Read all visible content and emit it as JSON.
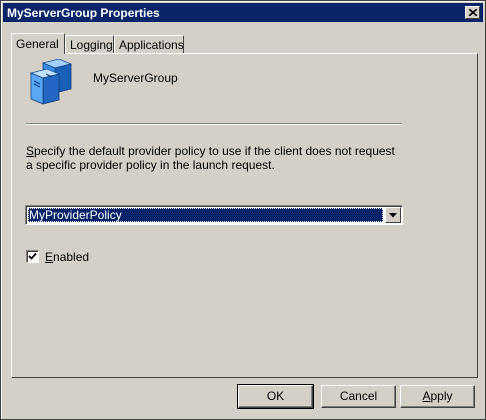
{
  "window": {
    "title": "MyServerGroup Properties"
  },
  "tabs": [
    {
      "label": "General",
      "active": true
    },
    {
      "label": "Logging",
      "active": false
    },
    {
      "label": "Applications",
      "active": false
    }
  ],
  "general": {
    "icon": "server-group-icon",
    "group_name": "MyServerGroup",
    "description": "Specify the default provider policy to use if the client does not request a specific provider policy in the launch request.",
    "policy_selected": "MyProviderPolicy",
    "enabled_label": "Enabled",
    "enabled_checked": true
  },
  "buttons": {
    "ok": "OK",
    "cancel": "Cancel",
    "apply": "Apply"
  },
  "colors": {
    "title_bar": "#0a246a",
    "dialog_face": "#d4d0c8",
    "selection": "#0a246a"
  }
}
